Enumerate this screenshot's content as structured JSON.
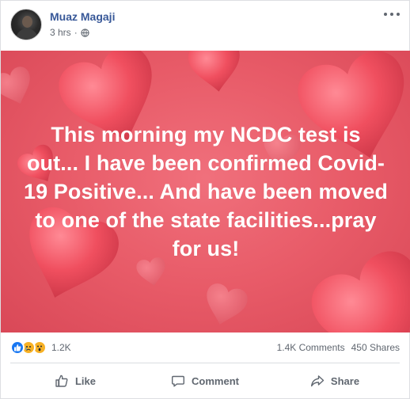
{
  "post": {
    "author": "Muaz Magaji",
    "time": "3 hrs",
    "meta_separator": "·",
    "privacy_icon": "globe-icon",
    "text": "This morning my NCDC test is out... I have been confirmed Covid-19 Positive... And have been moved to one of the state facilities...pray for us!",
    "background_theme": "red-hearts",
    "background_color": "#e85b68"
  },
  "stats": {
    "reaction_icons": [
      "like-icon",
      "sad-icon",
      "wow-icon"
    ],
    "reaction_count": "1.2K",
    "comments": "1.4K Comments",
    "shares": "450 Shares"
  },
  "actions": {
    "like": "Like",
    "comment": "Comment",
    "share": "Share"
  },
  "colors": {
    "author_link": "#385898",
    "like_blue": "#1877f2",
    "muted_text": "#606770"
  }
}
